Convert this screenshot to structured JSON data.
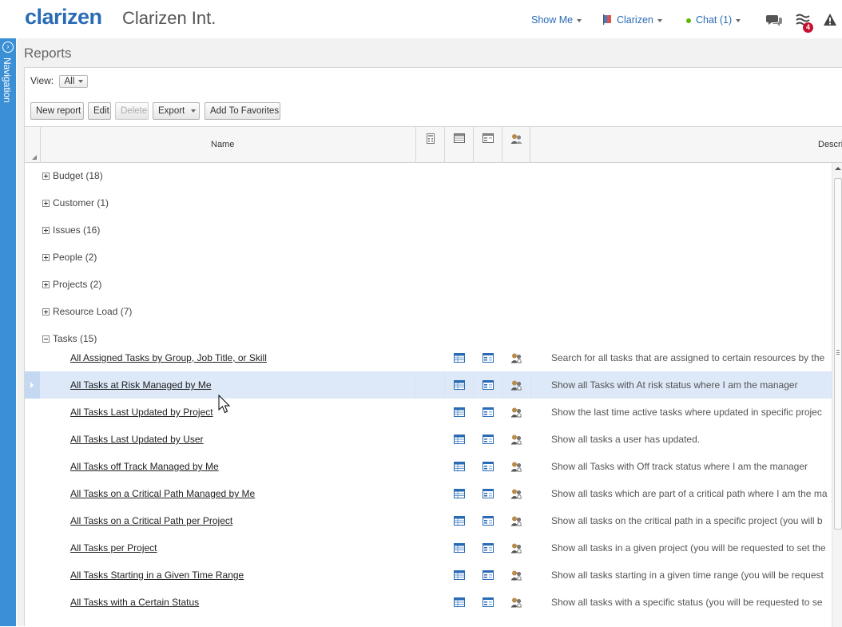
{
  "header": {
    "logo_text": "clarizen",
    "company_name": "Clarizen Int.",
    "show_me_label": "Show Me",
    "user_label": "Clarizen",
    "chat_label": "Chat (1)",
    "notifications_count": "4",
    "accent_color": "#2a6bb5"
  },
  "nav": {
    "label": "Navigation",
    "color": "#3b8fd4"
  },
  "page": {
    "title": "Reports"
  },
  "view": {
    "label": "View:",
    "selected": "All"
  },
  "toolbar": {
    "new_report": "New report",
    "edit": "Edit",
    "delete": "Delete",
    "export": "Export",
    "add_favorites": "Add To Favorites"
  },
  "grid": {
    "name_header": "Name",
    "description_header": "Descri",
    "groups": [
      {
        "label": "Budget (18)",
        "expanded": false
      },
      {
        "label": "Customer (1)",
        "expanded": false
      },
      {
        "label": "Issues (16)",
        "expanded": false
      },
      {
        "label": "People (2)",
        "expanded": false
      },
      {
        "label": "Projects (2)",
        "expanded": false
      },
      {
        "label": "Resource Load (7)",
        "expanded": false
      },
      {
        "label": "Tasks (15)",
        "expanded": true
      }
    ],
    "reports": [
      {
        "name": "All Assigned Tasks by Group, Job Title, or Skill",
        "description": "Search for all tasks that are assigned to certain resources by the"
      },
      {
        "name": "All Tasks at Risk Managed by Me",
        "description": "Show all Tasks with At risk status where I am the manager"
      },
      {
        "name": "All Tasks Last Updated by Project",
        "description": "Show the last time active tasks where updated in specific projec"
      },
      {
        "name": "All Tasks Last Updated by User",
        "description": "Show all tasks a user has updated."
      },
      {
        "name": "All Tasks off Track Managed by Me",
        "description": "Show all Tasks with Off track status where I am the manager"
      },
      {
        "name": "All Tasks on a Critical Path Managed by Me",
        "description": "Show all tasks which are part of a critical path where I am the ma"
      },
      {
        "name": "All Tasks on a Critical Path per Project",
        "description": "Show all tasks on the critical path in a specific project (you will b"
      },
      {
        "name": "All Tasks per Project",
        "description": "Show all tasks in a given project (you will be requested to set the"
      },
      {
        "name": "All Tasks Starting in a Given Time Range",
        "description": "Show all tasks starting in a given time range (you will be request"
      },
      {
        "name": "All Tasks with a Certain Status",
        "description": "Show all tasks with a specific status (you will be requested to se"
      }
    ]
  }
}
